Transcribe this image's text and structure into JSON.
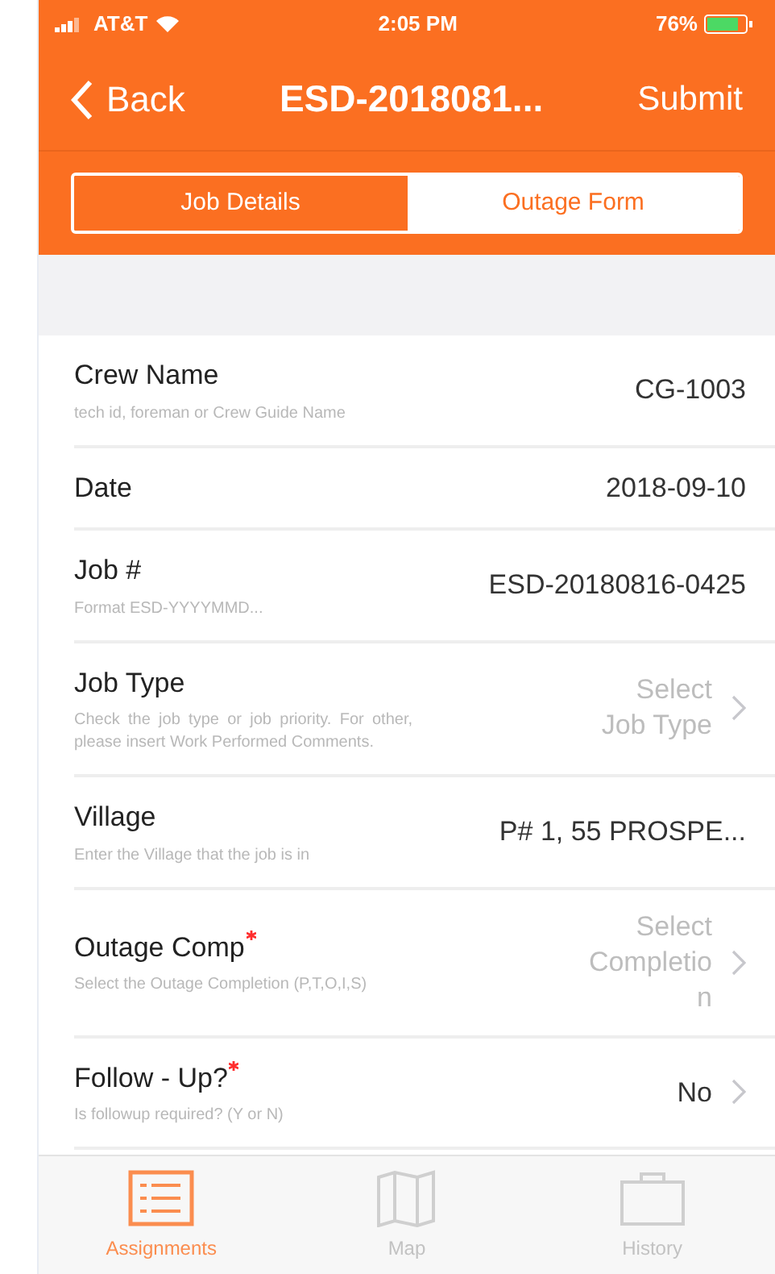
{
  "status_bar": {
    "carrier": "AT&T",
    "time": "2:05 PM",
    "battery": "76%"
  },
  "nav": {
    "back": "Back",
    "title": "ESD-2018081...",
    "action": "Submit"
  },
  "segments": [
    {
      "label": "Job Details",
      "selected": false
    },
    {
      "label": "Outage Form",
      "selected": true
    }
  ],
  "fields": [
    {
      "kind": "text",
      "label": "Crew Name",
      "required": false,
      "hint": "tech id, foreman or Crew Guide Name",
      "value": "CG-1003"
    },
    {
      "kind": "text",
      "label": "Date",
      "required": false,
      "value": "2018-09-10"
    },
    {
      "kind": "text",
      "label": "Job #",
      "required": false,
      "hint": "Format ESD-YYYYMMD...",
      "value": "ESD-20180816-0425"
    },
    {
      "kind": "select",
      "label": "Job Type",
      "required": false,
      "hint": "Check the job type or job priority. For other, please insert Work Performed Comments.",
      "placeholder": "Select Job Type"
    },
    {
      "kind": "text",
      "label": "Village",
      "required": false,
      "hint": "Enter the Village that the job is in",
      "value": "P# 1, 55 PROSPE..."
    },
    {
      "kind": "select",
      "label": "Outage Comp",
      "required": true,
      "hint": "Select the Outage Completion (P,T,O,I,S)",
      "placeholder": "Select Completion"
    },
    {
      "kind": "select",
      "label": "Follow - Up?",
      "required": true,
      "hint": "Is followup required?  (Y or N)",
      "value": "No"
    }
  ],
  "tab_bar": [
    {
      "label": "Assignments",
      "selected": true
    },
    {
      "label": "Map",
      "selected": false
    },
    {
      "label": "History",
      "selected": false
    }
  ]
}
